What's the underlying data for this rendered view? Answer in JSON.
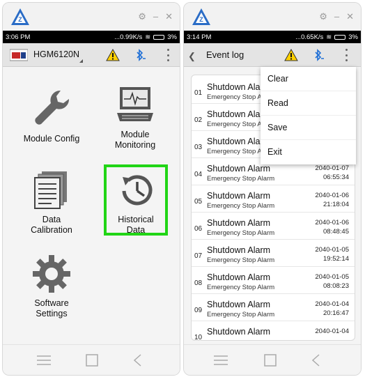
{
  "colors": {
    "highlight": "#21d516",
    "statusbar": "#000000",
    "toolbar": "#e4e4e4"
  },
  "left": {
    "status": {
      "time": "3:06 PM",
      "speed": "...0.99K/s",
      "battery": "3%"
    },
    "device_name": "HGM6120N",
    "icons": [
      "app-logo-icon",
      "gear-icon",
      "minimize-icon",
      "close-icon",
      "warning-icon",
      "bluetooth-icon",
      "more-vert-icon"
    ],
    "grid": [
      {
        "label": "Module Config",
        "icon": "wrench-icon"
      },
      {
        "label": "Module\nMonitoring",
        "icon": "monitor-icon"
      },
      {
        "label": "Data\nCalibration",
        "icon": "documents-icon"
      },
      {
        "label": "Historical\nData",
        "icon": "history-clock-icon"
      },
      {
        "label": "Software\nSettings",
        "icon": "gear-settings-icon"
      }
    ]
  },
  "right": {
    "status": {
      "time": "3:14 PM",
      "speed": "...0.65K/s",
      "battery": "3%"
    },
    "title": "Event log",
    "menu": [
      "Clear",
      "Read",
      "Save",
      "Exit"
    ],
    "rows": [
      {
        "no": "01",
        "title": "Shutdown Alarm",
        "sub": "Emergency Stop Alarm",
        "date": "",
        "time": ""
      },
      {
        "no": "02",
        "title": "Shutdown Alarm",
        "sub": "Emergency Stop Alarm",
        "date": "",
        "time": ""
      },
      {
        "no": "03",
        "title": "Shutdown Alarm",
        "sub": "Emergency Stop Alarm",
        "date": "",
        "time": ""
      },
      {
        "no": "04",
        "title": "Shutdown Alarm",
        "sub": "Emergency Stop Alarm",
        "date": "2040-01-07",
        "time": "06:55:34"
      },
      {
        "no": "05",
        "title": "Shutdown Alarm",
        "sub": "Emergency Stop Alarm",
        "date": "2040-01-06",
        "time": "21:18:04"
      },
      {
        "no": "06",
        "title": "Shutdown Alarm",
        "sub": "Emergency Stop Alarm",
        "date": "2040-01-06",
        "time": "08:48:45"
      },
      {
        "no": "07",
        "title": "Shutdown Alarm",
        "sub": "Emergency Stop Alarm",
        "date": "2040-01-05",
        "time": "19:52:14"
      },
      {
        "no": "08",
        "title": "Shutdown Alarm",
        "sub": "Emergency Stop Alarm",
        "date": "2040-01-05",
        "time": "08:08:23"
      },
      {
        "no": "09",
        "title": "Shutdown Alarm",
        "sub": "Emergency Stop Alarm",
        "date": "2040-01-04",
        "time": "20:16:47"
      },
      {
        "no": "10",
        "title": "Shutdown Alarm",
        "sub": "",
        "date": "2040-01-04",
        "time": ""
      }
    ]
  }
}
